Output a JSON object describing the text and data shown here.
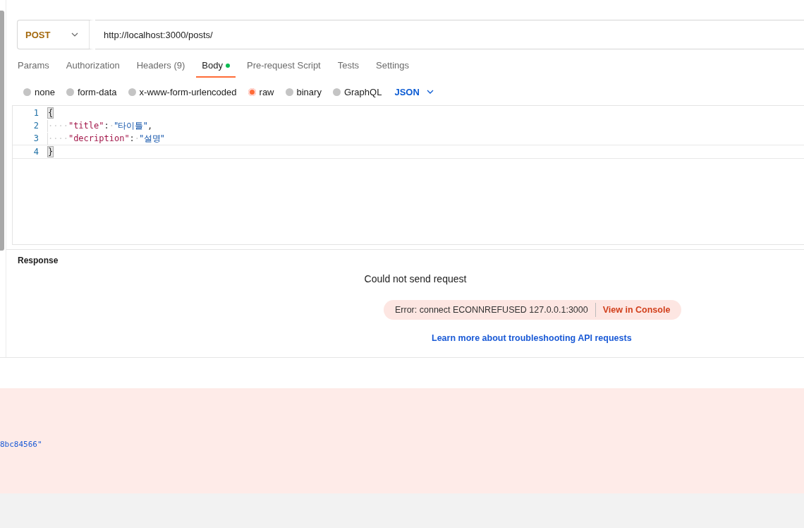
{
  "request": {
    "method": "POST",
    "url": "http://localhost:3000/posts/"
  },
  "tabs": [
    {
      "label": "Params",
      "selected": false,
      "indicator": false
    },
    {
      "label": "Authorization",
      "selected": false,
      "indicator": false
    },
    {
      "label": "Headers (9)",
      "selected": false,
      "indicator": false
    },
    {
      "label": "Body",
      "selected": true,
      "indicator": true
    },
    {
      "label": "Pre-request Script",
      "selected": false,
      "indicator": false
    },
    {
      "label": "Tests",
      "selected": false,
      "indicator": false
    },
    {
      "label": "Settings",
      "selected": false,
      "indicator": false
    }
  ],
  "body_types": [
    {
      "label": "none",
      "selected": false
    },
    {
      "label": "form-data",
      "selected": false
    },
    {
      "label": "x-www-form-urlencoded",
      "selected": false
    },
    {
      "label": "raw",
      "selected": true
    },
    {
      "label": "binary",
      "selected": false
    },
    {
      "label": "GraphQL",
      "selected": false
    }
  ],
  "format": "JSON",
  "editor": {
    "lines": [
      {
        "number": "1",
        "current": false,
        "tokens": [
          {
            "kind": "bracket",
            "text": "{"
          }
        ]
      },
      {
        "number": "2",
        "current": false,
        "tokens": [
          {
            "kind": "space",
            "text": "····"
          },
          {
            "kind": "key",
            "text": "\"title\""
          },
          {
            "kind": "punct",
            "text": ":"
          },
          {
            "kind": "space",
            "text": "·"
          },
          {
            "kind": "string",
            "text": "\"타이틀\""
          },
          {
            "kind": "punct",
            "text": ","
          }
        ]
      },
      {
        "number": "3",
        "current": false,
        "tokens": [
          {
            "kind": "space",
            "text": "····"
          },
          {
            "kind": "key",
            "text": "\"decription\""
          },
          {
            "kind": "punct",
            "text": ":"
          },
          {
            "kind": "space",
            "text": "·"
          },
          {
            "kind": "string",
            "text": "\"설명\""
          }
        ]
      },
      {
        "number": "4",
        "current": true,
        "tokens": [
          {
            "kind": "bracket",
            "text": "}"
          }
        ]
      }
    ]
  },
  "response": {
    "title": "Response",
    "message": "Could not send request",
    "error": "Error: connect ECONNREFUSED 127.0.0.1:3000",
    "console_link": "View in Console",
    "help_link": "Learn more about troubleshooting API requests"
  },
  "lower_panel": {
    "text": "8bc84566\""
  }
}
